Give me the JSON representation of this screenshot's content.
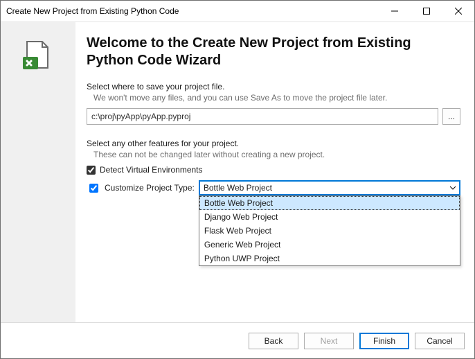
{
  "window": {
    "title": "Create New Project from Existing Python Code"
  },
  "heading": "Welcome to the Create New Project from Existing Python Code Wizard",
  "save": {
    "label": "Select where to save your project file.",
    "hint": "We won't move any files, and you can use Save As to move the project file later.",
    "path": "c:\\proj\\pyApp\\pyApp.pyproj",
    "browse": "..."
  },
  "features": {
    "label": "Select any other features for your project.",
    "hint": "These can not be changed later without creating a new project.",
    "detect_virtual_env": {
      "checked": true,
      "label": "Detect Virtual Environments"
    },
    "customize_type": {
      "checked": true,
      "label": "Customize Project Type:"
    }
  },
  "project_type": {
    "selected": "Bottle Web Project",
    "options": [
      "Bottle Web Project",
      "Django Web Project",
      "Flask Web Project",
      "Generic Web Project",
      "Python UWP Project"
    ]
  },
  "buttons": {
    "back": "Back",
    "next": "Next",
    "finish": "Finish",
    "cancel": "Cancel"
  }
}
